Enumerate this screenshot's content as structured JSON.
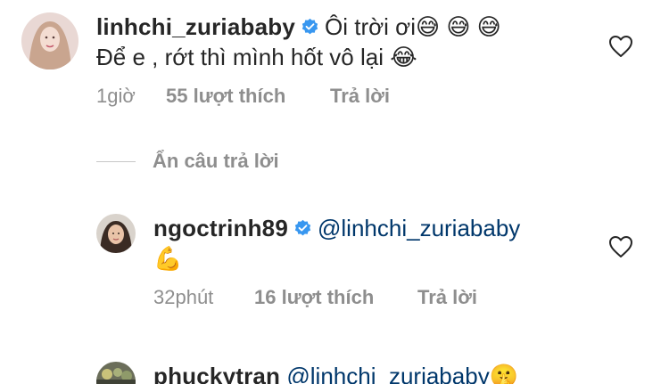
{
  "comments": [
    {
      "username": "linhchi_zuriababy",
      "verified": true,
      "line1": "Ôi trời ơi",
      "line1_emoji": "😅 😅 😅",
      "line2": "Để e , rớt thì mình hốt vô lại",
      "line2_emoji": "😂",
      "time": "1giờ",
      "likes": "55 lượt thích",
      "reply": "Trả lời"
    },
    {
      "username": "ngoctrinh89",
      "verified": true,
      "mention": "@linhchi_zuriababy",
      "line2_emoji": "💪",
      "time": "32phút",
      "likes": "16 lượt thích",
      "reply": "Trả lời"
    },
    {
      "username": "phuckytran",
      "mention": "@linhchi_zuriababy",
      "emoji": "🤫"
    }
  ],
  "hide_replies": "Ẩn câu trả lời",
  "colors": {
    "text": "#262626",
    "meta": "#8e8e8e",
    "mention": "#00376b",
    "verified": "#3897f0",
    "divider": "#c7c7c7"
  },
  "icons": {
    "like": "heart-outline-icon",
    "verified": "verified-badge-icon"
  }
}
